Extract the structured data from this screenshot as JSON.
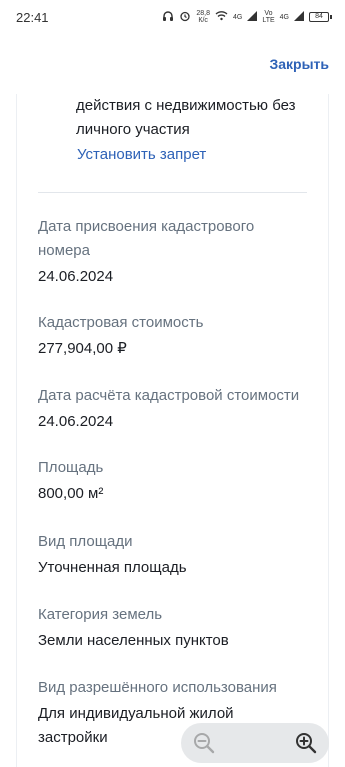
{
  "status_bar": {
    "time": "22:41",
    "speed": "28,8\nК/с",
    "net1": "4G",
    "net2": "Vo\nLTE",
    "net3": "4G",
    "battery": "84"
  },
  "header": {
    "close_label": "Закрыть"
  },
  "notice": {
    "text": "действия с недвижимостью без личного участия",
    "link": "Установить запрет"
  },
  "fields": [
    {
      "label": "Дата присвоения кадастрового номера",
      "value": "24.06.2024"
    },
    {
      "label": "Кадастровая стоимость",
      "value": "277,904,00 ₽"
    },
    {
      "label": "Дата расчёта кадастровой стоимости",
      "value": "24.06.2024"
    },
    {
      "label": "Площадь",
      "value": "800,00 м²"
    },
    {
      "label": "Вид площади",
      "value": "Уточненная площадь"
    },
    {
      "label": "Категория земель",
      "value": "Земли населенных пунктов"
    },
    {
      "label": "Вид разрешённого использования",
      "value": "Для индивидуальной жилой застройки"
    }
  ],
  "colors": {
    "accent": "#2e62b7",
    "label": "#66727f",
    "text": "#1b1e24"
  },
  "icons": {
    "zoom_out": "zoom-out-icon",
    "zoom_in": "zoom-in-icon"
  }
}
